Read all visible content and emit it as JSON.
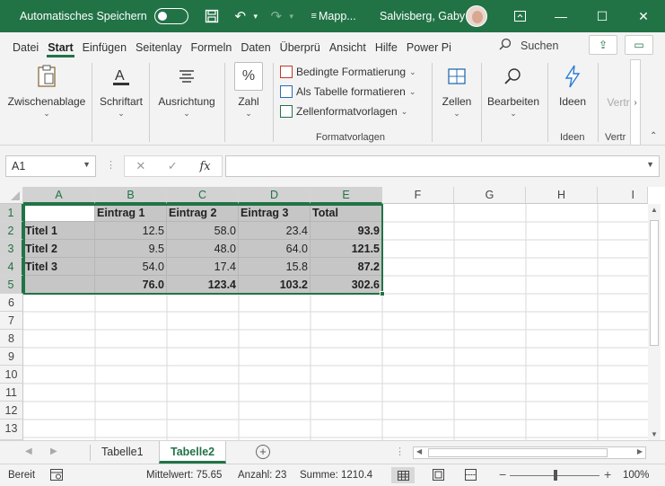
{
  "titlebar": {
    "autosave_label": "Automatisches Speichern",
    "filename": "Mapp...",
    "user": "Salvisberg, Gaby",
    "minimize": "—",
    "restore": "☐",
    "close": "✕"
  },
  "tabs": [
    "Datei",
    "Start",
    "Einfügen",
    "Seitenlay",
    "Formeln",
    "Daten",
    "Überprü",
    "Ansicht",
    "Hilfe",
    "Power Pi"
  ],
  "active_tab": "Start",
  "search_label": "Suchen",
  "ribbon": {
    "clipboard": "Zwischenablage",
    "font": "Schriftart",
    "alignment": "Ausrichtung",
    "number": "Zahl",
    "cond_format": "Bedingte Formatierung",
    "as_table": "Als Tabelle formatieren",
    "cell_styles": "Zellenformatvorlagen",
    "styles_group": "Formatvorlagen",
    "cells": "Zellen",
    "edit": "Bearbeiten",
    "ideas": "Ideen",
    "ideas_group": "Ideen",
    "confidential": "Vertr",
    "confidential_group": "Vertr"
  },
  "formula_bar": {
    "name_box": "A1",
    "fx": "fx",
    "value": ""
  },
  "columns": [
    "A",
    "B",
    "C",
    "D",
    "E",
    "F",
    "G",
    "H",
    "I"
  ],
  "rows": [
    "1",
    "2",
    "3",
    "4",
    "5",
    "6",
    "7",
    "8",
    "9",
    "10",
    "11",
    "12",
    "13"
  ],
  "table": {
    "headers": [
      "",
      "Eintrag 1",
      "Eintrag 2",
      "Eintrag 3",
      "Total"
    ],
    "rows": [
      [
        "Titel 1",
        "12.5",
        "58.0",
        "23.4",
        "93.9"
      ],
      [
        "Titel 2",
        "9.5",
        "48.0",
        "64.0",
        "121.5"
      ],
      [
        "Titel 3",
        "54.0",
        "17.4",
        "15.8",
        "87.2"
      ],
      [
        "",
        "76.0",
        "123.4",
        "103.2",
        "302.6"
      ]
    ]
  },
  "sheets": [
    "Tabelle1",
    "Tabelle2"
  ],
  "active_sheet": "Tabelle2",
  "status": {
    "ready": "Bereit",
    "average": "Mittelwert: 75.65",
    "count": "Anzahl: 23",
    "sum": "Summe: 1210.4",
    "zoom": "100%"
  },
  "colors": {
    "accent": "#217346",
    "selection_fill": "#c6c6c6"
  }
}
